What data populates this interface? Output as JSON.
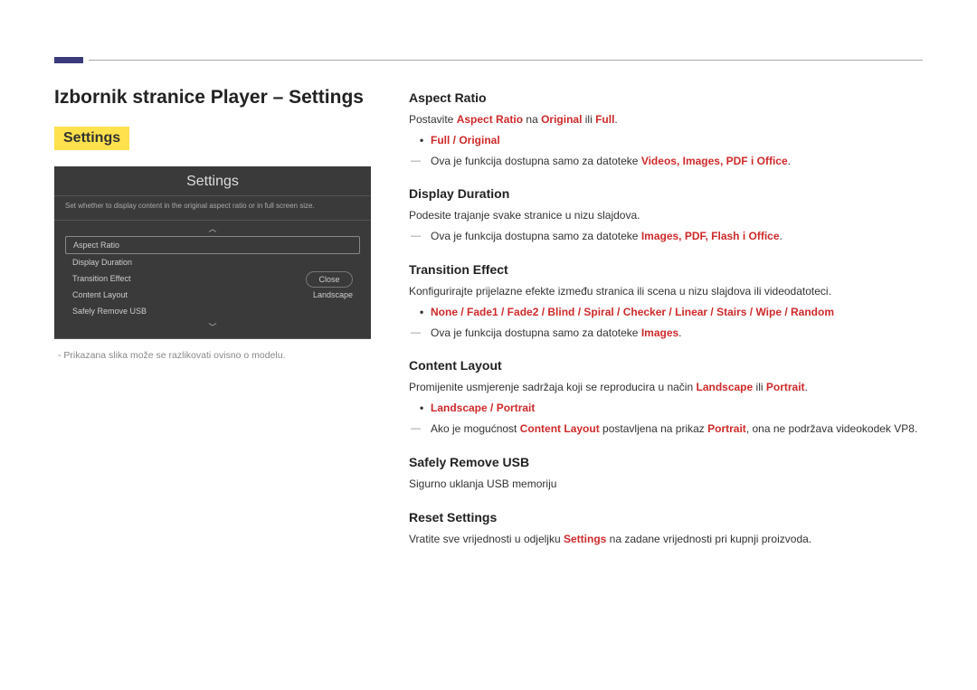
{
  "page_title": "Izbornik stranice Player – Settings",
  "sub_title": "Settings",
  "panel": {
    "title": "Settings",
    "desc": "Set whether to display content in the original aspect ratio or in full screen size.",
    "items": [
      {
        "label": "Aspect Ratio",
        "value": ""
      },
      {
        "label": "Display Duration",
        "value": ""
      },
      {
        "label": "Transition Effect",
        "value": ""
      },
      {
        "label": "Content Layout",
        "value": "Landscape"
      },
      {
        "label": "Safely Remove USB",
        "value": ""
      }
    ],
    "close": "Close",
    "arrow_up": "︿",
    "arrow_down": "﹀"
  },
  "panel_note": "- Prikazana slika može se razlikovati ovisno o modelu.",
  "sections": {
    "aspect": {
      "heading": "Aspect Ratio",
      "intro_pre": "Postavite ",
      "intro_em": "Aspect Ratio",
      "intro_mid": " na ",
      "intro_o1": "Original",
      "intro_or": " ili ",
      "intro_o2": "Full",
      "intro_end": ".",
      "bullet": "Full / Original",
      "note_pre": "Ova je funkcija dostupna samo za datoteke ",
      "note_terms": "Videos, Images, PDF i Office",
      "note_end": "."
    },
    "display": {
      "heading": "Display Duration",
      "intro": "Podesite trajanje svake stranice u nizu slajdova.",
      "note_pre": "Ova je funkcija dostupna samo za datoteke ",
      "note_terms": "Images, PDF, Flash i Office",
      "note_end": "."
    },
    "trans": {
      "heading": "Transition Effect",
      "intro": "Konfigurirajte prijelazne efekte između stranica ili scena u nizu slajdova ili videodatoteci.",
      "bullet": "None / Fade1 / Fade2 / Blind / Spiral / Checker / Linear / Stairs / Wipe / Random",
      "note_pre": "Ova je funkcija dostupna samo za datoteke ",
      "note_terms": "Images",
      "note_end": "."
    },
    "layout": {
      "heading": "Content Layout",
      "intro_pre": "Promijenite usmjerenje sadržaja koji se reproducira u način ",
      "intro_o1": "Landscape",
      "intro_or": " ili ",
      "intro_o2": "Portrait",
      "intro_end": ".",
      "bullet": "Landscape / Portrait",
      "note_pre": "Ako je mogućnost ",
      "note_em1": "Content Layout",
      "note_mid": " postavljena na prikaz ",
      "note_em2": "Portrait",
      "note_post": ", ona ne podržava videokodek VP8."
    },
    "usb": {
      "heading": "Safely Remove USB",
      "intro": "Sigurno uklanja USB memoriju"
    },
    "reset": {
      "heading": "Reset Settings",
      "intro_pre": "Vratite sve vrijednosti u odjeljku ",
      "intro_em": "Settings",
      "intro_post": " na zadane vrijednosti pri kupnji proizvoda."
    }
  }
}
